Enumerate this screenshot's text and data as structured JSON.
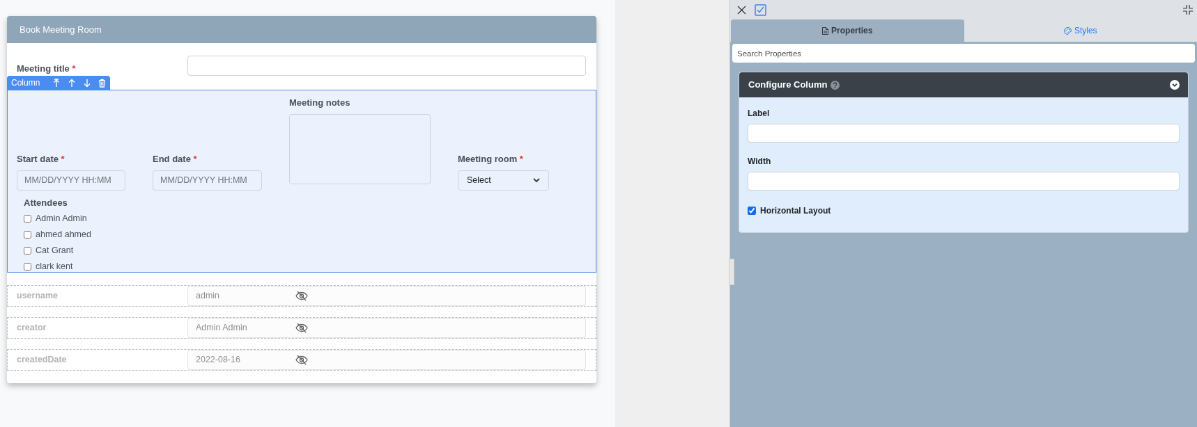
{
  "form": {
    "title": "Book Meeting Room",
    "meeting_title": {
      "label": "Meeting title",
      "required_mark": "*"
    },
    "column_toolbar": {
      "label": "Column"
    },
    "start_date": {
      "label": "Start date",
      "required_mark": "*",
      "placeholder": "MM/DD/YYYY HH:MM"
    },
    "end_date": {
      "label": "End date",
      "required_mark": "*",
      "placeholder": "MM/DD/YYYY HH:MM"
    },
    "meeting_notes": {
      "label": "Meeting notes"
    },
    "meeting_room": {
      "label": "Meeting room",
      "required_mark": "*",
      "value": "Select"
    },
    "attendees": {
      "label": "Attendees",
      "options": [
        {
          "label": "Admin Admin",
          "checked": false
        },
        {
          "label": "ahmed ahmed",
          "checked": false
        },
        {
          "label": "Cat Grant",
          "checked": false
        },
        {
          "label": "clark kent",
          "checked": false
        }
      ]
    },
    "hidden_fields": [
      {
        "label": "username",
        "value": "admin"
      },
      {
        "label": "creator",
        "value": "Admin Admin"
      },
      {
        "label": "createdDate",
        "value": "2022-08-16"
      }
    ]
  },
  "properties_panel": {
    "tabs": [
      {
        "label": "Properties",
        "selected": true
      },
      {
        "label": "Styles",
        "selected": false
      }
    ],
    "search": {
      "placeholder": "Search Properties"
    },
    "section": {
      "title": "Configure Column",
      "fields": [
        {
          "label": "Label"
        },
        {
          "label": "Width"
        }
      ],
      "horizontal_layout": {
        "label": "Horizontal Layout",
        "checked": true
      }
    }
  }
}
